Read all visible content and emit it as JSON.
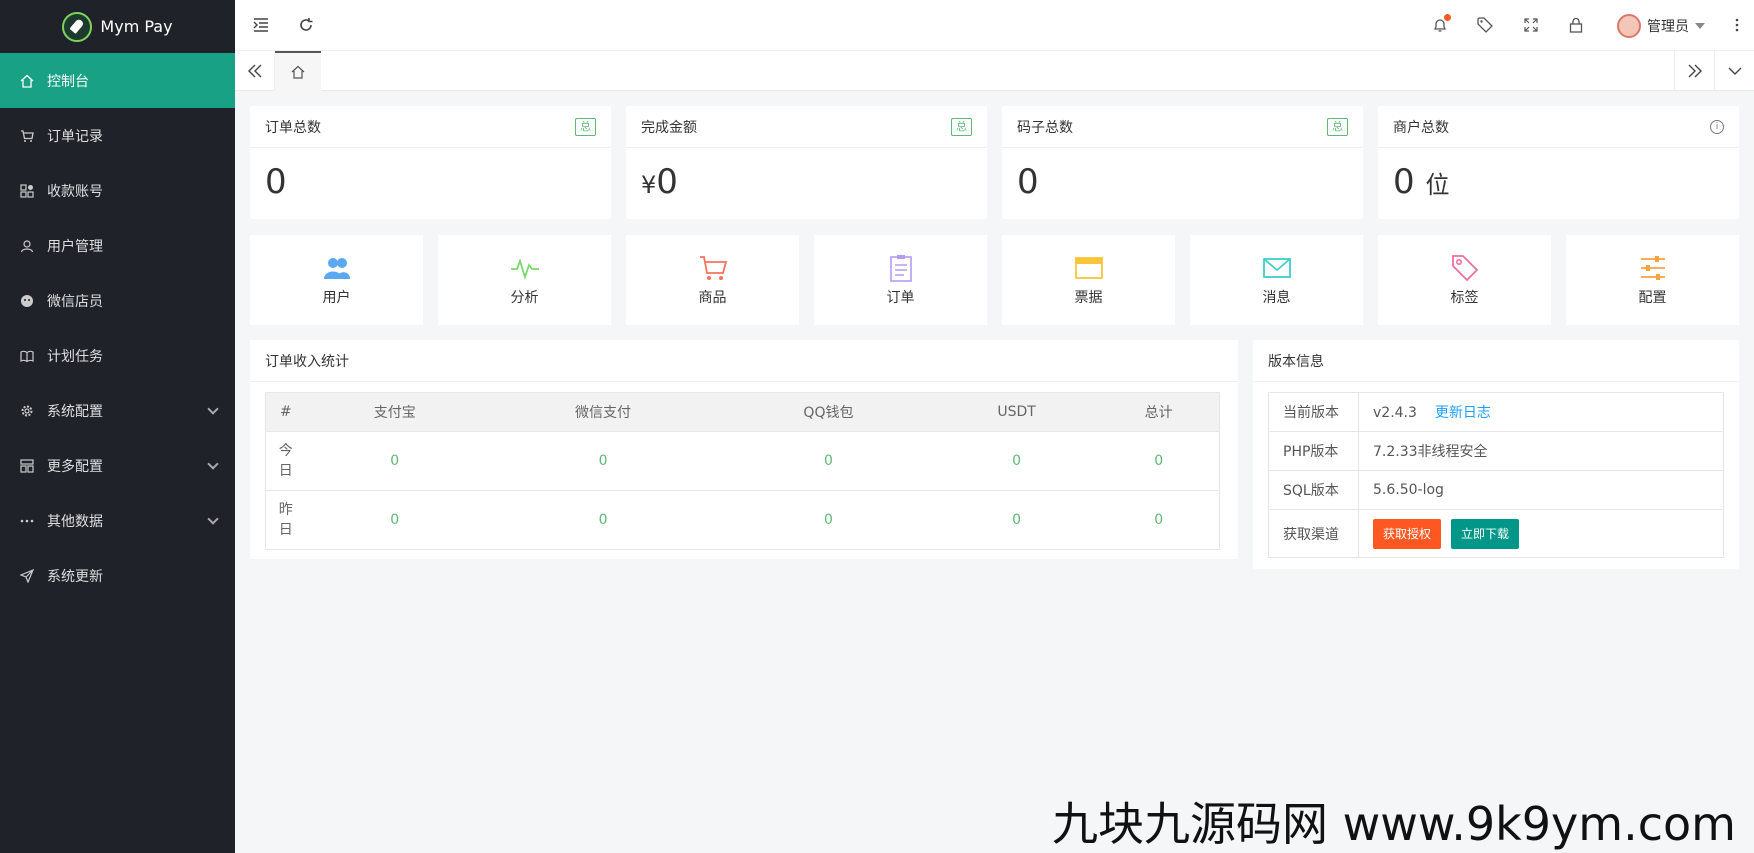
{
  "app": {
    "name": "Mym Pay"
  },
  "sidebar": {
    "items": [
      {
        "label": "控制台",
        "icon": "home-icon",
        "active": true
      },
      {
        "label": "订单记录",
        "icon": "cart-icon"
      },
      {
        "label": "收款账号",
        "icon": "apps-icon"
      },
      {
        "label": "用户管理",
        "icon": "user-icon"
      },
      {
        "label": "微信店员",
        "icon": "wechat-icon"
      },
      {
        "label": "计划任务",
        "icon": "book-icon"
      },
      {
        "label": "系统配置",
        "icon": "gear-icon",
        "expandable": true
      },
      {
        "label": "更多配置",
        "icon": "template-icon",
        "expandable": true
      },
      {
        "label": "其他数据",
        "icon": "more-icon",
        "expandable": true
      },
      {
        "label": "系统更新",
        "icon": "send-icon"
      }
    ]
  },
  "header": {
    "admin_name": "管理员"
  },
  "stats": [
    {
      "title": "订单总数",
      "tag": "总",
      "value": "0",
      "prefix": "",
      "suffix": ""
    },
    {
      "title": "完成金额",
      "tag": "总",
      "value": "0",
      "prefix": "¥",
      "suffix": ""
    },
    {
      "title": "码子总数",
      "tag": "总",
      "value": "0",
      "prefix": "",
      "suffix": ""
    },
    {
      "title": "商户总数",
      "tag": "",
      "value": "0",
      "prefix": "",
      "suffix": "位"
    }
  ],
  "shortcuts": [
    {
      "label": "用户",
      "icon": "users-icon",
      "color": "#5aa8f0"
    },
    {
      "label": "分析",
      "icon": "pulse-icon",
      "color": "#7bd86a"
    },
    {
      "label": "商品",
      "icon": "cart-icon",
      "color": "#f5735a"
    },
    {
      "label": "订单",
      "icon": "clipboard-icon",
      "color": "#b59af2"
    },
    {
      "label": "票据",
      "icon": "ticket-icon",
      "color": "#f8c53a"
    },
    {
      "label": "消息",
      "icon": "mail-icon",
      "color": "#3fd0c8"
    },
    {
      "label": "标签",
      "icon": "tag-icon",
      "color": "#f06f9a"
    },
    {
      "label": "配置",
      "icon": "sliders-icon",
      "color": "#f7a23e"
    }
  ],
  "orders": {
    "title": "订单收入统计",
    "columns": [
      "#",
      "支付宝",
      "微信支付",
      "QQ钱包",
      "USDT",
      "总计"
    ],
    "rows": [
      {
        "label": "今日",
        "values": [
          "0",
          "0",
          "0",
          "0",
          "0"
        ]
      },
      {
        "label": "昨日",
        "values": [
          "0",
          "0",
          "0",
          "0",
          "0"
        ]
      }
    ]
  },
  "version": {
    "title": "版本信息",
    "current_label": "当前版本",
    "current_value": "v2.4.3",
    "changelog": "更新日志",
    "php_label": "PHP版本",
    "php_value": "7.2.33非线程安全",
    "sql_label": "SQL版本",
    "sql_value": "5.6.50-log",
    "channel_label": "获取渠道",
    "btn_auth": "获取授权",
    "btn_download": "立即下载"
  },
  "watermark": "九块九源码网 www.9k9ym.com"
}
